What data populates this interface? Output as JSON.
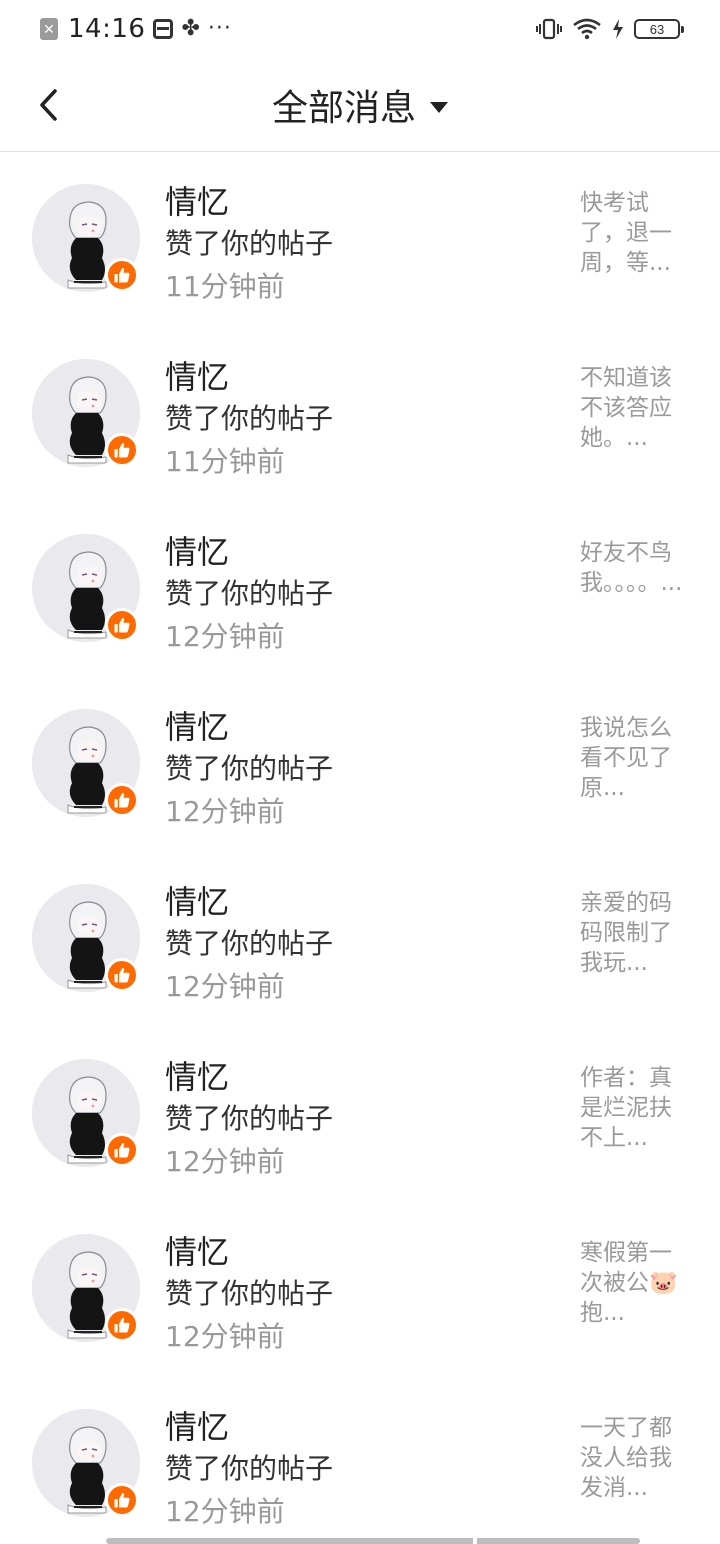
{
  "status_bar": {
    "time": "14:16",
    "left_icons": [
      "close-notification-icon",
      "sim-card-icon",
      "fan-icon",
      "more-dots-icon"
    ],
    "right_icons": [
      "vibrate-icon",
      "wifi-icon",
      "charging-icon"
    ],
    "battery": "63",
    "dots": "···"
  },
  "header": {
    "title": "全部消息",
    "back_icon": "chevron-left-icon",
    "dropdown_icon": "caret-down-icon"
  },
  "colors": {
    "accent": "#ff6a00",
    "text_primary": "#222222",
    "text_secondary": "#999999"
  },
  "messages": [
    {
      "name": "情忆",
      "action": "赞了你的帖子",
      "time": "11分钟前",
      "preview": ""
    },
    {
      "name": "情忆",
      "action": "赞了你的帖子",
      "time": "11分钟前",
      "preview": "快考试了，退一周，等..."
    },
    {
      "name": "情忆",
      "action": "赞了你的帖子",
      "time": "11分钟前",
      "preview": "不知道该不该答应她。..."
    },
    {
      "name": "情忆",
      "action": "赞了你的帖子",
      "time": "12分钟前",
      "preview": "好友不鸟我。。。。..."
    },
    {
      "name": "情忆",
      "action": "赞了你的帖子",
      "time": "12分钟前",
      "preview": "我说怎么看不见了原..."
    },
    {
      "name": "情忆",
      "action": "赞了你的帖子",
      "time": "12分钟前",
      "preview": "亲爱的码码限制了我玩..."
    },
    {
      "name": "情忆",
      "action": "赞了你的帖子",
      "time": "12分钟前",
      "preview": "作者：真是烂泥扶不上..."
    },
    {
      "name": "情忆",
      "action": "赞了你的帖子",
      "time": "12分钟前",
      "preview": "寒假第一次被公🐷抱..."
    },
    {
      "name": "情忆",
      "action": "赞了你的帖子",
      "time": "12分钟前",
      "preview": "一天了都没人给我发消..."
    }
  ]
}
